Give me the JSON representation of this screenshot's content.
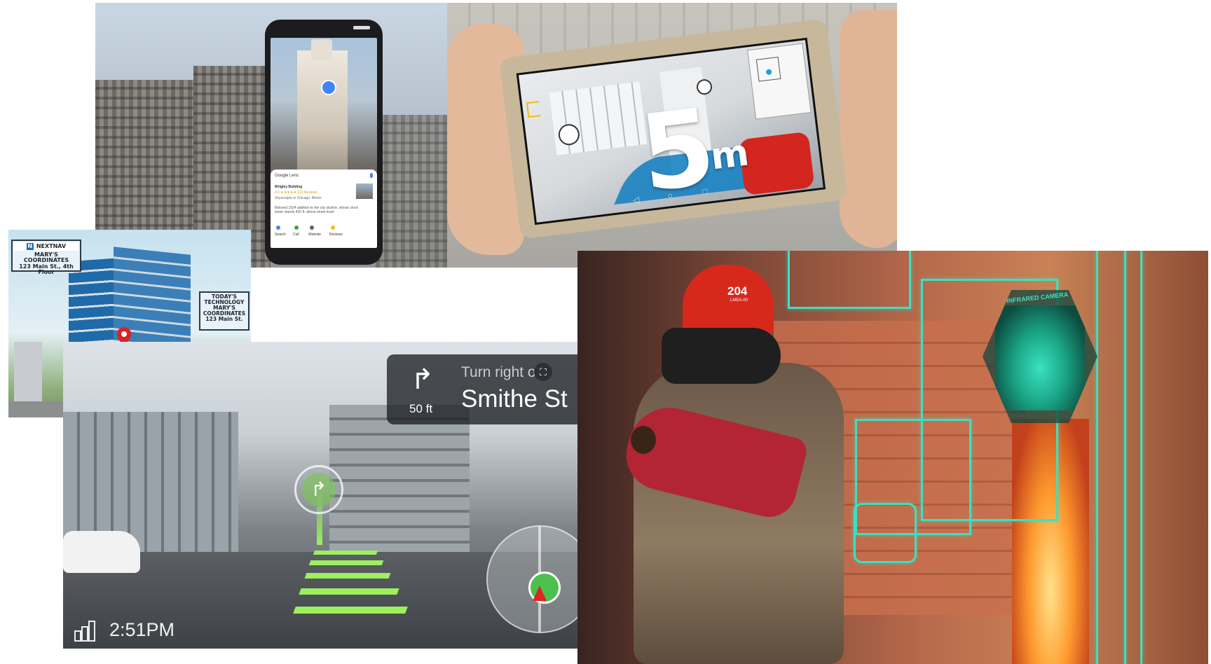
{
  "lens": {
    "app_name": "Google Lens",
    "place_name": "Wrigley Building",
    "rating": "4.5 ★★★★★ 123 Reviews",
    "place_type": "Skyscraper in Chicago, Illinois",
    "description": "Beloved 1924 addition to the city skyline, whose clock tower stands 425 ft. above street level.",
    "actions": [
      "Search",
      "Call",
      "Website",
      "Reviews"
    ]
  },
  "indoor_nav": {
    "distance_number": "5",
    "distance_unit": "m"
  },
  "nextnav": {
    "brand": "NEXTNAV",
    "left_sign": [
      "MARY'S",
      "COORDINATES",
      "123 Main St., 4th Floor"
    ],
    "right_sign": [
      "TODAY'S",
      "TECHNOLOGY",
      "MARY'S",
      "COORDINATES",
      "123 Main St."
    ]
  },
  "car_nav": {
    "distance": "50 ft",
    "instruction": "Turn right on",
    "street": "Smithe St",
    "time": "2:51PM"
  },
  "firefighter": {
    "helmet_number": "204",
    "helmet_label": "LMEA-00",
    "hud_label": "INFRARED CAMERA"
  },
  "colors": {
    "ar_green": "#9cf05e",
    "hud_cyan": "#3be0c2",
    "lens_blue": "#4285f4",
    "helmet_red": "#d7281c"
  }
}
